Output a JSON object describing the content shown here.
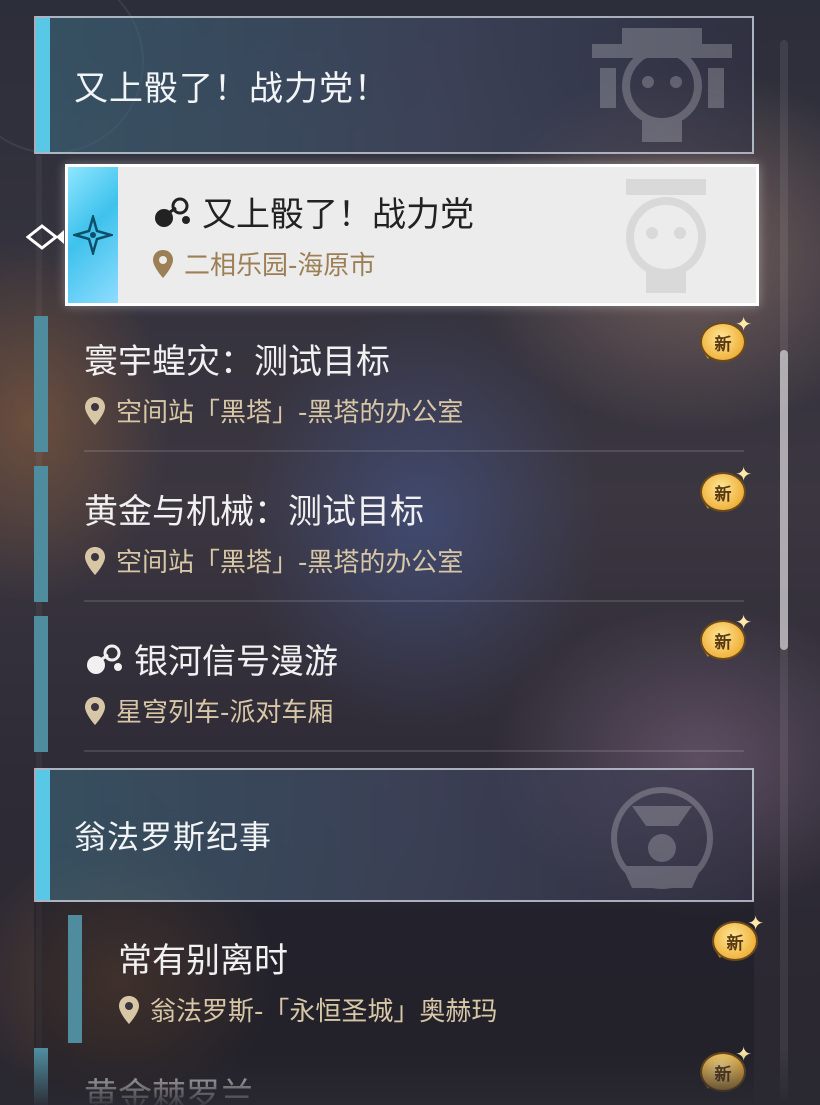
{
  "groups": [
    {
      "title": "又上骰了！战力党！"
    },
    {
      "title": "翁法罗斯纪事"
    }
  ],
  "selected_quest": {
    "title": "又上骰了！战力党",
    "location": "二相乐园-海原市",
    "type_icon": "dice-quest-icon"
  },
  "quests": [
    {
      "title": "寰宇蝗灾：测试目标",
      "location": "空间站「黑塔」-黑塔的办公室",
      "badge": "新"
    },
    {
      "title": "黄金与机械：测试目标",
      "location": "空间站「黑塔」-黑塔的办公室",
      "badge": "新"
    },
    {
      "title": "银河信号漫游",
      "location": "星穹列车-派对车厢",
      "badge": "新",
      "type_icon": "dice-quest-icon"
    },
    {
      "title": "常有别离时",
      "location": "翁法罗斯-「永恒圣城」奥赫玛",
      "badge": "新"
    },
    {
      "title": "黄金棘罗兰",
      "location": "",
      "badge": "新"
    }
  ],
  "colors": {
    "group_accent": "#58c8e6",
    "quest_bar": "#4f8c9e",
    "location_text": "#d8c7a6",
    "badge": "#f0b33d"
  }
}
